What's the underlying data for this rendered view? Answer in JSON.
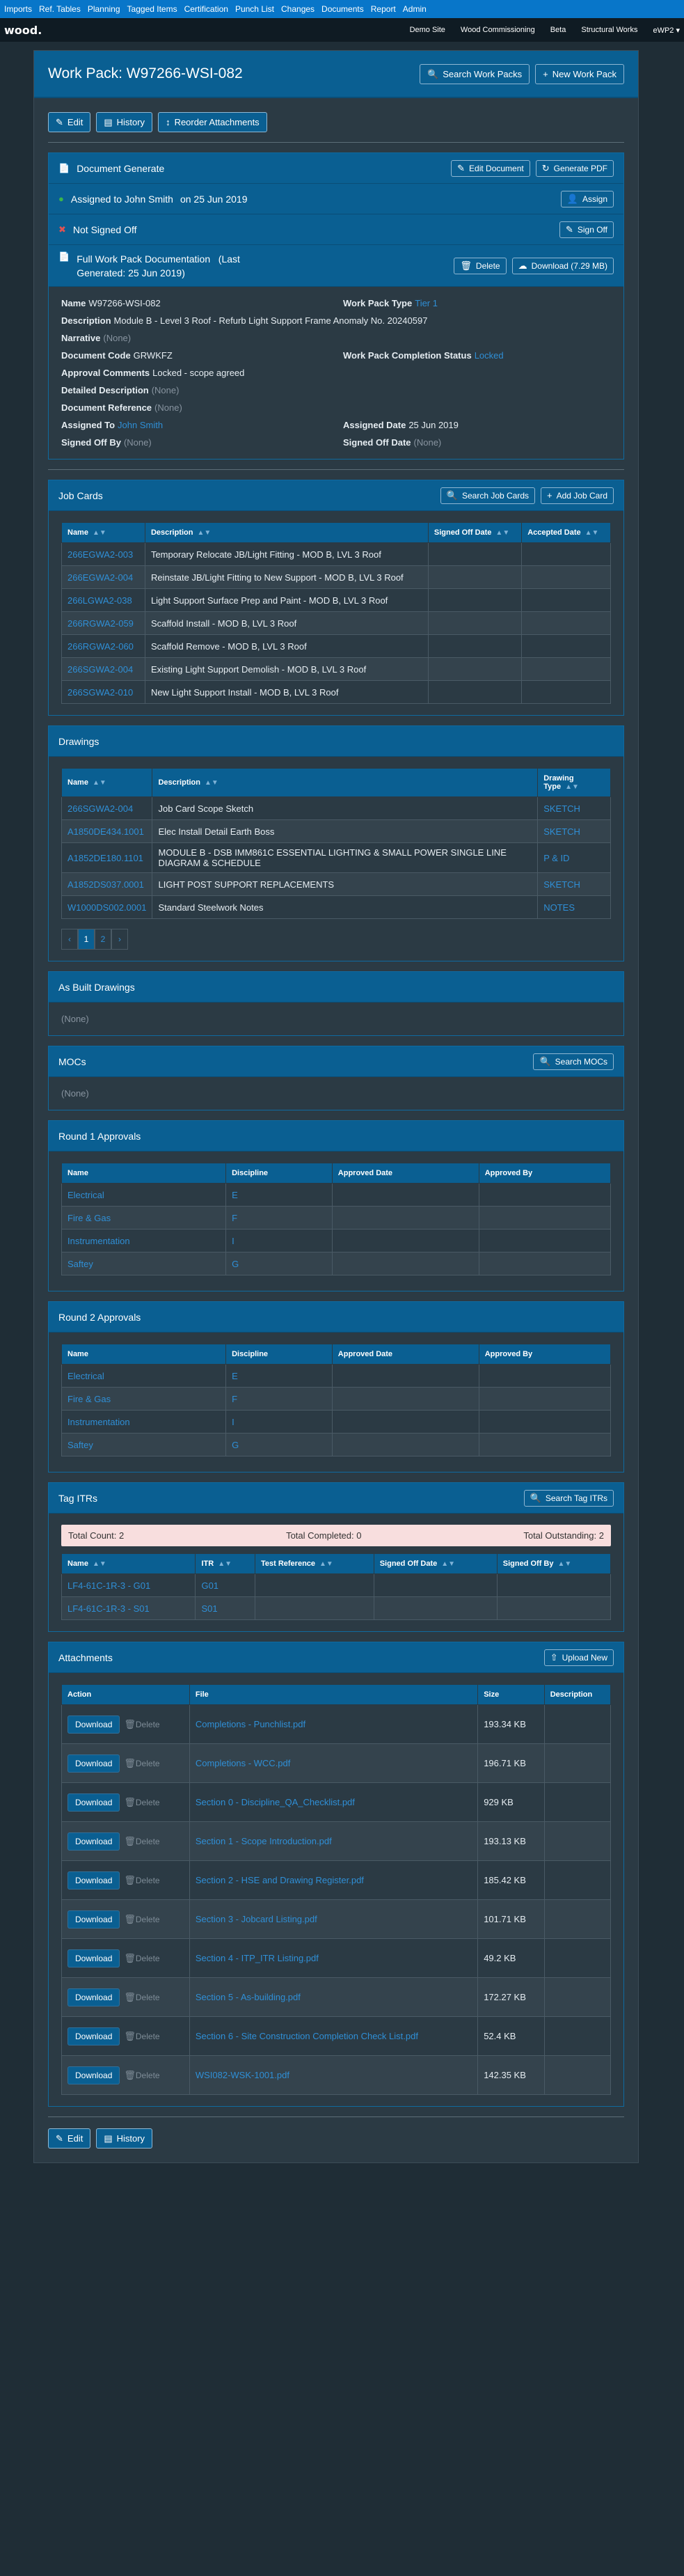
{
  "topnav": [
    "Imports",
    "Ref. Tables",
    "Planning",
    "Tagged Items",
    "Certification",
    "Punch List",
    "Changes",
    "Documents",
    "Report",
    "Admin"
  ],
  "brand": "wood.",
  "subnav": [
    "Demo Site",
    "Wood Commissioning",
    "Beta",
    "Structural Works",
    "eWP2 ▾"
  ],
  "header": {
    "title": "Work Pack: W97266-WSI-082",
    "search": "Search Work Packs",
    "new": "New Work Pack"
  },
  "actions": {
    "edit": "Edit",
    "history": "History",
    "reorder": "Reorder Attachments"
  },
  "docgen": {
    "title": "Document Generate",
    "edit_doc": "Edit Document",
    "gen_pdf": "Generate PDF"
  },
  "assign": {
    "text": "Assigned to John Smith",
    "date": "on 25 Jun 2019",
    "btn": "Assign"
  },
  "signoff": {
    "text": "Not Signed Off",
    "btn": "Sign Off"
  },
  "fullwp": {
    "text": "Full Work Pack Documentation",
    "gen": "(Last Generated: 25 Jun 2019)",
    "del": "Delete",
    "download": "Download (7.29 MB)"
  },
  "details": {
    "name_l": "Name",
    "name_v": "W97266-WSI-082",
    "type_l": "Work Pack Type",
    "type_v": "Tier 1",
    "desc_l": "Description",
    "desc_v": "Module B - Level 3 Roof - Refurb Light Support Frame Anomaly No. 20240597",
    "narr_l": "Narrative",
    "narr_v": "(None)",
    "code_l": "Document Code",
    "code_v": "GRWKFZ",
    "comp_l": "Work Pack Completion Status",
    "comp_v": "Locked",
    "appr_l": "Approval Comments",
    "appr_v": "Locked - scope agreed",
    "dd_l": "Detailed Description",
    "dd_v": "(None)",
    "ref_l": "Document Reference",
    "ref_v": "(None)",
    "assto_l": "Assigned To",
    "assto_v": "John Smith",
    "assd_l": "Assigned Date",
    "assd_v": "25 Jun 2019",
    "sob_l": "Signed Off By",
    "sob_v": "(None)",
    "sod_l": "Signed Off Date",
    "sod_v": "(None)"
  },
  "jobcards": {
    "title": "Job Cards",
    "search": "Search Job Cards",
    "add": "Add Job Card",
    "cols": [
      "Name",
      "Description",
      "Signed Off Date",
      "Accepted Date"
    ],
    "rows": [
      [
        "266EGWA2-003",
        "Temporary Relocate JB/Light Fitting - MOD B, LVL 3 Roof"
      ],
      [
        "266EGWA2-004",
        "Reinstate JB/Light Fitting to New Support - MOD B, LVL 3 Roof"
      ],
      [
        "266LGWA2-038",
        "Light Support Surface Prep and Paint - MOD B, LVL 3 Roof"
      ],
      [
        "266RGWA2-059",
        "Scaffold Install - MOD B, LVL 3 Roof"
      ],
      [
        "266RGWA2-060",
        "Scaffold Remove - MOD B, LVL 3 Roof"
      ],
      [
        "266SGWA2-004",
        "Existing Light Support Demolish - MOD B, LVL 3 Roof"
      ],
      [
        "266SGWA2-010",
        "New Light Support Install - MOD B, LVL 3 Roof"
      ]
    ]
  },
  "drawings": {
    "title": "Drawings",
    "cols": [
      "Name",
      "Description",
      "Drawing Type"
    ],
    "rows": [
      [
        "266SGWA2-004",
        "Job Card Scope Sketch",
        "SKETCH"
      ],
      [
        "A1850DE434.1001",
        "Elec Install Detail Earth Boss",
        "SKETCH"
      ],
      [
        "A1852DE180.1101",
        "MODULE B - DSB IMM861C ESSENTIAL LIGHTING & SMALL POWER SINGLE LINE DIAGRAM & SCHEDULE",
        "P & ID"
      ],
      [
        "A1852DS037.0001",
        "LIGHT POST SUPPORT REPLACEMENTS",
        "SKETCH"
      ],
      [
        "W1000DS002.0001",
        "Standard Steelwork Notes",
        "NOTES"
      ]
    ],
    "pages": [
      "‹",
      "1",
      "2",
      "›"
    ]
  },
  "asbuilt": {
    "title": "As Built Drawings",
    "none": "(None)"
  },
  "mocs": {
    "title": "MOCs",
    "search": "Search MOCs",
    "none": "(None)"
  },
  "round1": {
    "title": "Round 1 Approvals",
    "cols": [
      "Name",
      "Discipline",
      "Approved Date",
      "Approved By"
    ],
    "rows": [
      [
        "Electrical",
        "E"
      ],
      [
        "Fire & Gas",
        "F"
      ],
      [
        "Instrumentation",
        "I"
      ],
      [
        "Saftey",
        "G"
      ]
    ]
  },
  "round2": {
    "title": "Round 2 Approvals",
    "cols": [
      "Name",
      "Discipline",
      "Approved Date",
      "Approved By"
    ],
    "rows": [
      [
        "Electrical",
        "E"
      ],
      [
        "Fire & Gas",
        "F"
      ],
      [
        "Instrumentation",
        "I"
      ],
      [
        "Saftey",
        "G"
      ]
    ]
  },
  "tagitrs": {
    "title": "Tag ITRs",
    "search": "Search Tag ITRs",
    "count": "Total Count: 2",
    "completed": "Total Completed: 0",
    "outstanding": "Total Outstanding: 2",
    "cols": [
      "Name",
      "ITR",
      "Test Reference",
      "Signed Off Date",
      "Signed Off By"
    ],
    "rows": [
      [
        "LF4-61C-1R-3 - G01",
        "G01"
      ],
      [
        "LF4-61C-1R-3 - S01",
        "S01"
      ]
    ]
  },
  "attachments": {
    "title": "Attachments",
    "upload": "Upload New",
    "cols": [
      "Action",
      "File",
      "Size",
      "Description"
    ],
    "download": "Download",
    "delete": "Delete",
    "rows": [
      [
        "Completions - Punchlist.pdf",
        "193.34 KB"
      ],
      [
        "Completions - WCC.pdf",
        "196.71 KB"
      ],
      [
        "Section 0 - Discipline_QA_Checklist.pdf",
        "929 KB"
      ],
      [
        "Section 1 - Scope Introduction.pdf",
        "193.13 KB"
      ],
      [
        "Section 2 - HSE and Drawing Register.pdf",
        "185.42 KB"
      ],
      [
        "Section 3 - Jobcard Listing.pdf",
        "101.71 KB"
      ],
      [
        "Section 4 - ITP_ITR Listing.pdf",
        "49.2 KB"
      ],
      [
        "Section 5 - As-building.pdf",
        "172.27 KB"
      ],
      [
        "Section 6 - Site Construction Completion Check List.pdf",
        "52.4 KB"
      ],
      [
        "WSI082-WSK-1001.pdf",
        "142.35 KB"
      ]
    ]
  }
}
